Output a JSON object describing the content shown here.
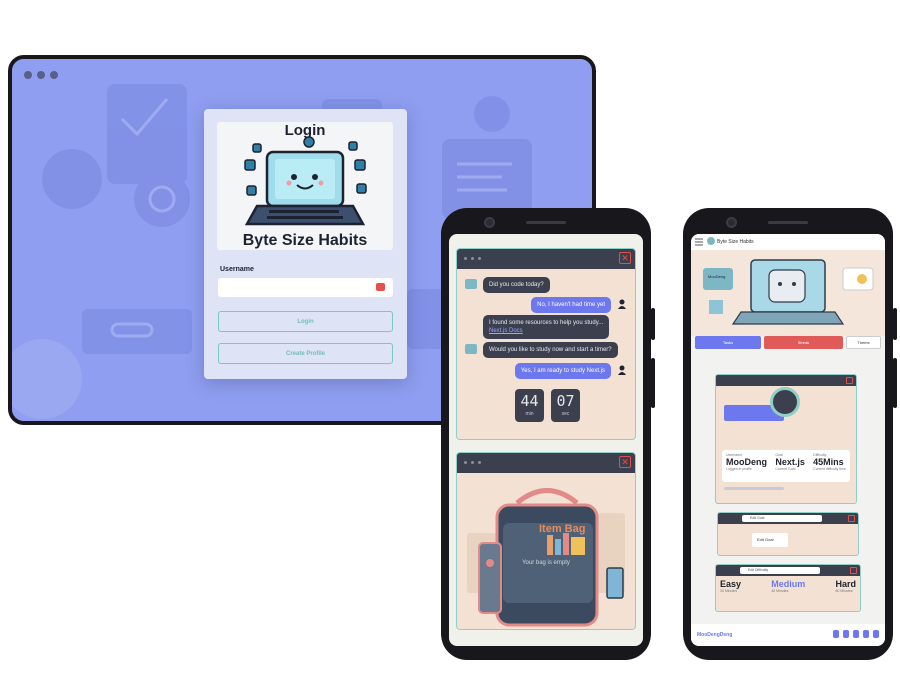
{
  "desktop": {
    "logo_title_top": "Login",
    "logo_title_bottom": "Byte Size Habits",
    "username_label": "Username",
    "username_value": "",
    "login_button": "Login",
    "create_profile_button": "Create Profile",
    "bg_color": "#8f9ef0"
  },
  "chat_phone": {
    "messages": [
      {
        "from": "bot",
        "text": "Did you code today?"
      },
      {
        "from": "me",
        "text": "No, I haven't had time yet"
      },
      {
        "from": "bot",
        "text": "I found some resources to help you study...",
        "link": "Next.js Docs"
      },
      {
        "from": "bot",
        "text": "Would you like to study now and start a timer?"
      },
      {
        "from": "me",
        "text": "Yes, I am ready to study Next.js"
      }
    ],
    "timer": {
      "minutes": "44",
      "min_label": "min",
      "seconds": "07",
      "sec_label": "sec"
    },
    "bag_title": "Item Bag",
    "bag_empty_text": "Your bag is empty"
  },
  "dashboard_phone": {
    "title": "Byte Size Habits",
    "hero_left_badge": "MooDeng",
    "tabs": [
      {
        "label": "Tasks",
        "color": "#6d78ef"
      },
      {
        "label": "Streak",
        "color": "#e05a5a"
      },
      {
        "label": "Theme",
        "color": "#ffffff"
      }
    ],
    "stats": [
      {
        "label": "Username",
        "value": "MooDeng",
        "sub": "Logged in profile"
      },
      {
        "label": "Goal",
        "value": "Next.js",
        "sub": "Current Goal"
      },
      {
        "label": "Difficulty",
        "value": "45Mins",
        "sub": "Current difficulty time"
      }
    ],
    "edit_goal_search": "Edit Goal",
    "edit_goal_button": "Edit Goal",
    "edit_difficulty_search": "Edit Difficulty",
    "difficulties": [
      {
        "name": "Easy",
        "time": "30 Minutes",
        "color": "#20242e"
      },
      {
        "name": "Medium",
        "time": "45 Minutes",
        "color": "#6d78ef"
      },
      {
        "name": "Hard",
        "time": "60 Minutes",
        "color": "#20242e"
      }
    ],
    "footer_brand": "MooDengDeng"
  }
}
